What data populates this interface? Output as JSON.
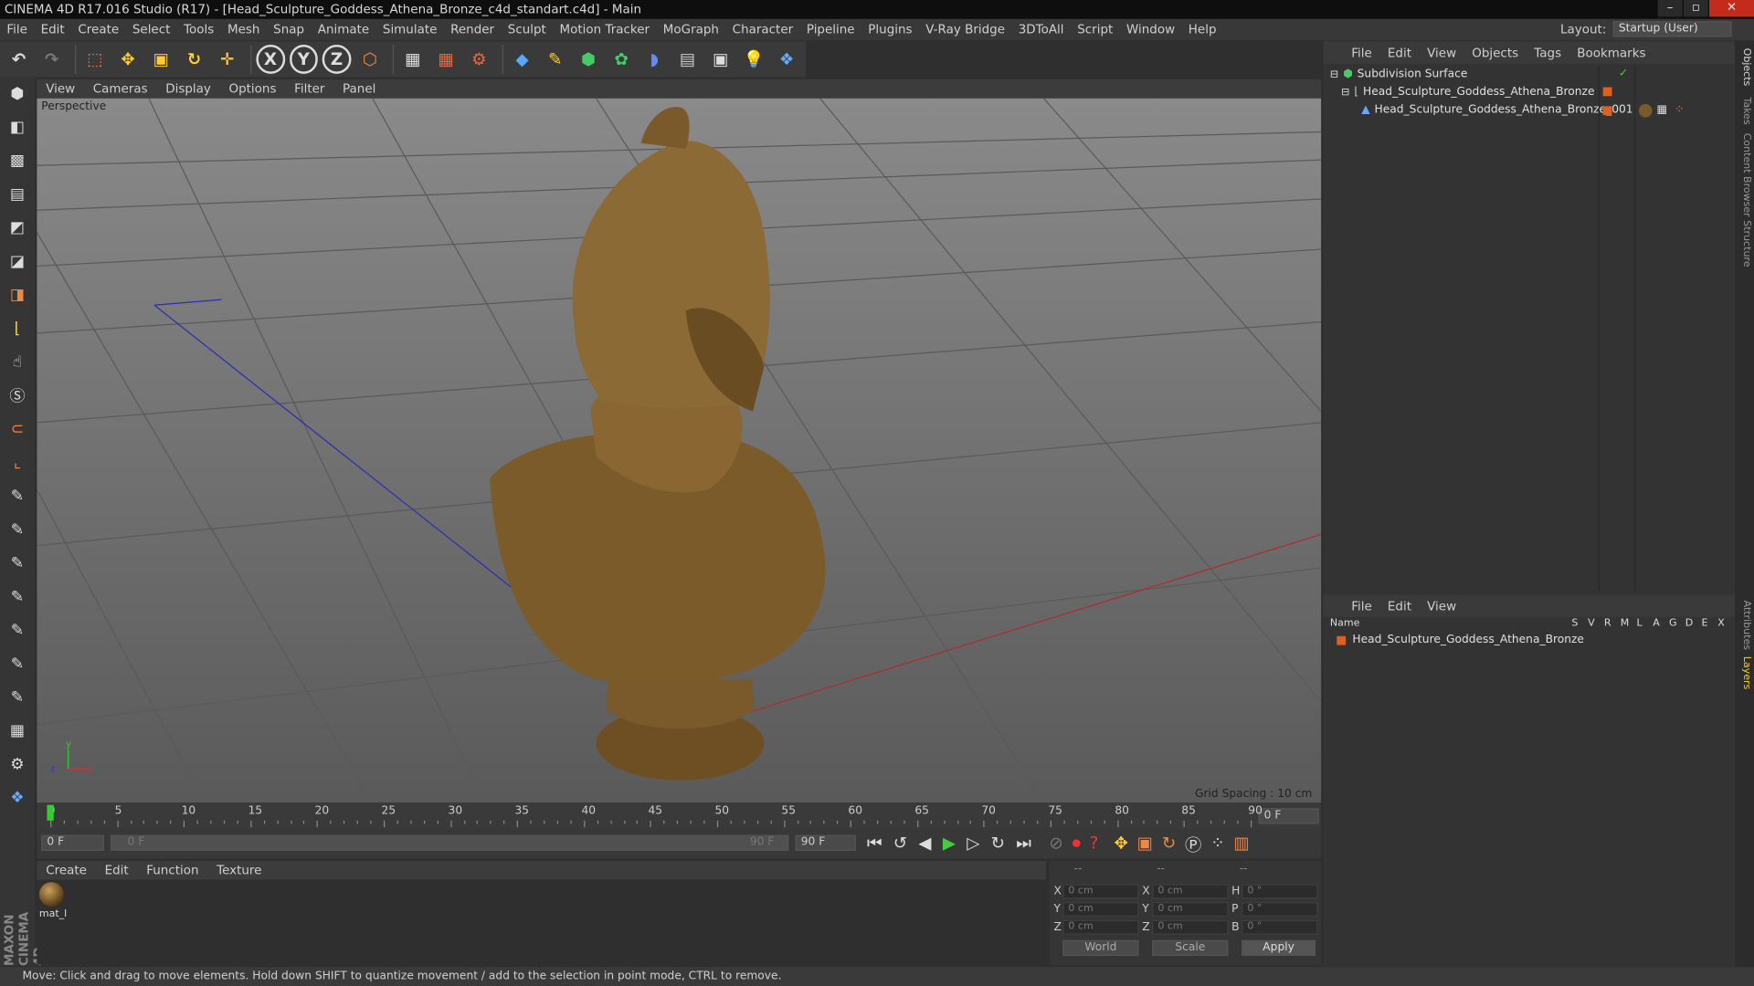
{
  "title": "CINEMA 4D R17.016 Studio (R17) - [Head_Sculpture_Goddess_Athena_Bronze_c4d_standart.c4d] - Main",
  "menu": [
    "File",
    "Edit",
    "Create",
    "Select",
    "Tools",
    "Mesh",
    "Snap",
    "Animate",
    "Simulate",
    "Render",
    "Sculpt",
    "Motion Tracker",
    "MoGraph",
    "Character",
    "Pipeline",
    "Plugins",
    "V-Ray Bridge",
    "3DToAll",
    "Script",
    "Window",
    "Help"
  ],
  "layout_label": "Layout:",
  "layout_value": "Startup (User)",
  "viewport_menu": [
    "View",
    "Cameras",
    "Display",
    "Options",
    "Filter",
    "Panel"
  ],
  "viewport_label": "Perspective",
  "grid_spacing": "Grid Spacing : 10 cm",
  "timeline_ticks": [
    "0",
    "5",
    "10",
    "15",
    "20",
    "25",
    "30",
    "35",
    "40",
    "45",
    "50",
    "55",
    "60",
    "65",
    "70",
    "75",
    "80",
    "85",
    "90"
  ],
  "timeline_end": "0 F",
  "frame_start": "0 F",
  "range_start": "0 F",
  "range_end": "90 F",
  "frame_end": "90 F",
  "material_menu": [
    "Create",
    "Edit",
    "Function",
    "Texture"
  ],
  "material_name": "mat_l",
  "coords": {
    "headers": [
      "--",
      "--",
      "--"
    ],
    "rows": [
      {
        "l1": "X",
        "v1": "0 cm",
        "l2": "X",
        "v2": "0 cm",
        "l3": "H",
        "v3": "0 °"
      },
      {
        "l1": "Y",
        "v1": "0 cm",
        "l2": "Y",
        "v2": "0 cm",
        "l3": "P",
        "v3": "0 °"
      },
      {
        "l1": "Z",
        "v1": "0 cm",
        "l2": "Z",
        "v2": "0 cm",
        "l3": "B",
        "v3": "0 °"
      }
    ],
    "world": "World",
    "scale": "Scale",
    "apply": "Apply"
  },
  "status": "Move: Click and drag to move elements. Hold down SHIFT to quantize movement / add to the selection in point mode, CTRL to remove.",
  "objects_menu": [
    "File",
    "Edit",
    "View",
    "Objects",
    "Tags",
    "Bookmarks"
  ],
  "objects": [
    "Subdivision Surface",
    "Head_Sculpture_Goddess_Athena_Bronze",
    "Head_Sculpture_Goddess_Athena_Bronze_001"
  ],
  "layers_menu": [
    "File",
    "Edit",
    "View"
  ],
  "layers_header": {
    "name": "Name",
    "cols": [
      "S",
      "V",
      "R",
      "M",
      "L",
      "A",
      "G",
      "D",
      "E",
      "X"
    ]
  },
  "layer_name": "Head_Sculpture_Goddess_Athena_Bronze",
  "right_tabs": [
    "Objects",
    "Takes",
    "Content Browser",
    "Structure",
    "Attributes",
    "Layers"
  ],
  "logo": "MAXON CINEMA 4D"
}
